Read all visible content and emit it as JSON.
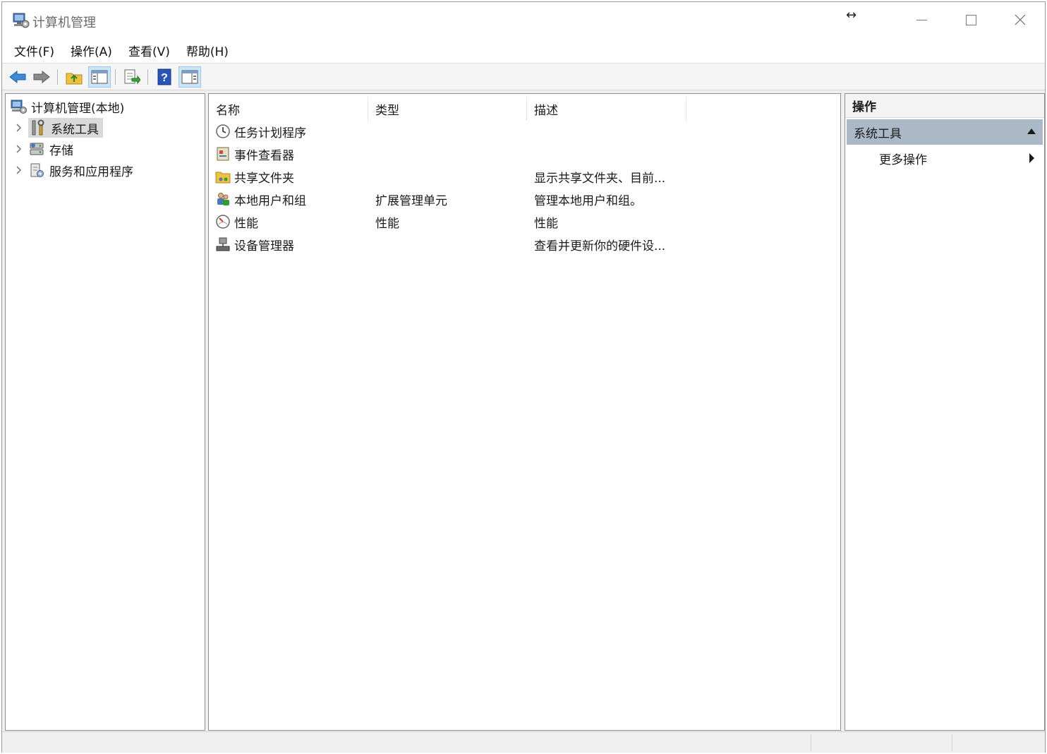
{
  "window": {
    "title": "计算机管理",
    "resize_glyph": "↔"
  },
  "menu": [
    {
      "label": "文件(F)"
    },
    {
      "label": "操作(A)"
    },
    {
      "label": "查看(V)"
    },
    {
      "label": "帮助(H)"
    }
  ],
  "toolbar": {
    "buttons": [
      {
        "icon": "back-arrow-icon"
      },
      {
        "icon": "forward-arrow-icon"
      },
      {
        "icon": "up-folder-icon"
      },
      {
        "icon": "show-hide-console-tree-icon"
      },
      {
        "icon": "export-list-icon"
      },
      {
        "icon": "help-icon"
      },
      {
        "icon": "show-hide-action-pane-icon"
      }
    ]
  },
  "tree": {
    "root": "计算机管理(本地)",
    "items": [
      {
        "label": "系统工具",
        "icon": "tools-icon",
        "selected": true
      },
      {
        "label": "存储",
        "icon": "storage-icon",
        "selected": false
      },
      {
        "label": "服务和应用程序",
        "icon": "services-icon",
        "selected": false
      }
    ]
  },
  "list": {
    "columns": [
      "名称",
      "类型",
      "描述"
    ],
    "rows": [
      {
        "name": "任务计划程序",
        "type": "",
        "desc": "",
        "icon": "clock-icon"
      },
      {
        "name": "事件查看器",
        "type": "",
        "desc": "",
        "icon": "event-viewer-icon"
      },
      {
        "name": "共享文件夹",
        "type": "",
        "desc": "显示共享文件夹、目前...",
        "icon": "shared-folder-icon"
      },
      {
        "name": "本地用户和组",
        "type": "扩展管理单元",
        "desc": "管理本地用户和组。",
        "icon": "users-icon"
      },
      {
        "name": "性能",
        "type": "性能",
        "desc": "性能",
        "icon": "performance-icon"
      },
      {
        "name": "设备管理器",
        "type": "",
        "desc": "查看并更新你的硬件设...",
        "icon": "device-manager-icon"
      }
    ]
  },
  "actions": {
    "title": "操作",
    "section": "系统工具",
    "items": [
      {
        "label": "更多操作"
      }
    ]
  },
  "colors": {
    "section_bg": "#aab8c8",
    "selected_tree_bg": "#d9d9d9",
    "active_toolbar_bg": "#cce4f7"
  }
}
